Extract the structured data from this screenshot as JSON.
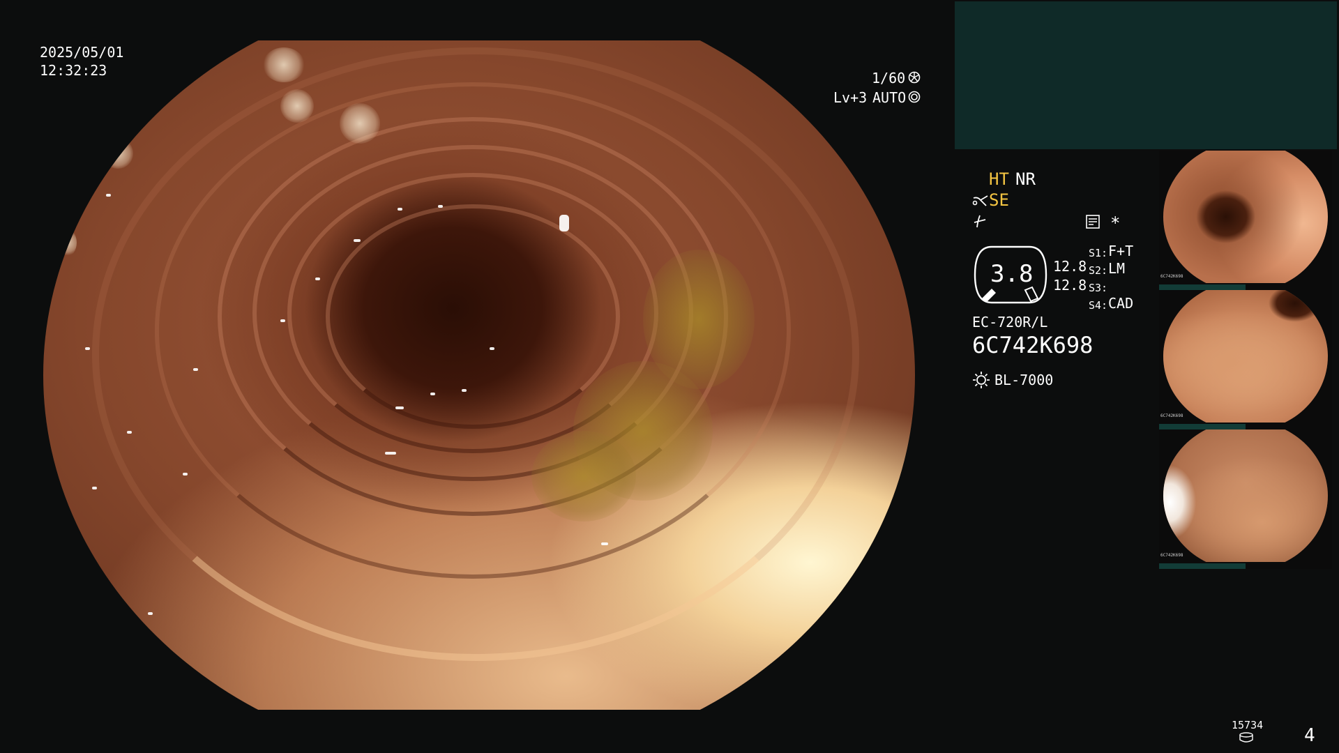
{
  "overlay": {
    "date": "2025/05/01",
    "time": "12:32:23",
    "shutter": "1/60",
    "level": "Lv+3",
    "auto": "AUTO"
  },
  "settings": {
    "ht": "HT",
    "nr": "NR",
    "se": "SE",
    "zoom": "3.8",
    "val_a": "12.8",
    "val_b": "12.8",
    "s1_key": "S1:",
    "s1_val": "F+T",
    "s2_key": "S2:",
    "s2_val": "LM",
    "s3_key": "S3:",
    "s3_val": "",
    "s4_key": "S4:",
    "s4_val": "CAD",
    "asterisk": "*"
  },
  "device": {
    "scope_model": "EC-720R/L",
    "serial": "6C742K698",
    "light_source": "BL-7000"
  },
  "footer": {
    "counter": "15734",
    "image_count": "4"
  },
  "colors": {
    "highlight": "#f5c542",
    "panel": "#0f2a28",
    "strip": "#123c37"
  },
  "icons": [
    "shutter-icon",
    "auto-iris-icon",
    "scissors-icon",
    "filter-icon",
    "memo-icon",
    "sun-icon",
    "disk-icon"
  ]
}
